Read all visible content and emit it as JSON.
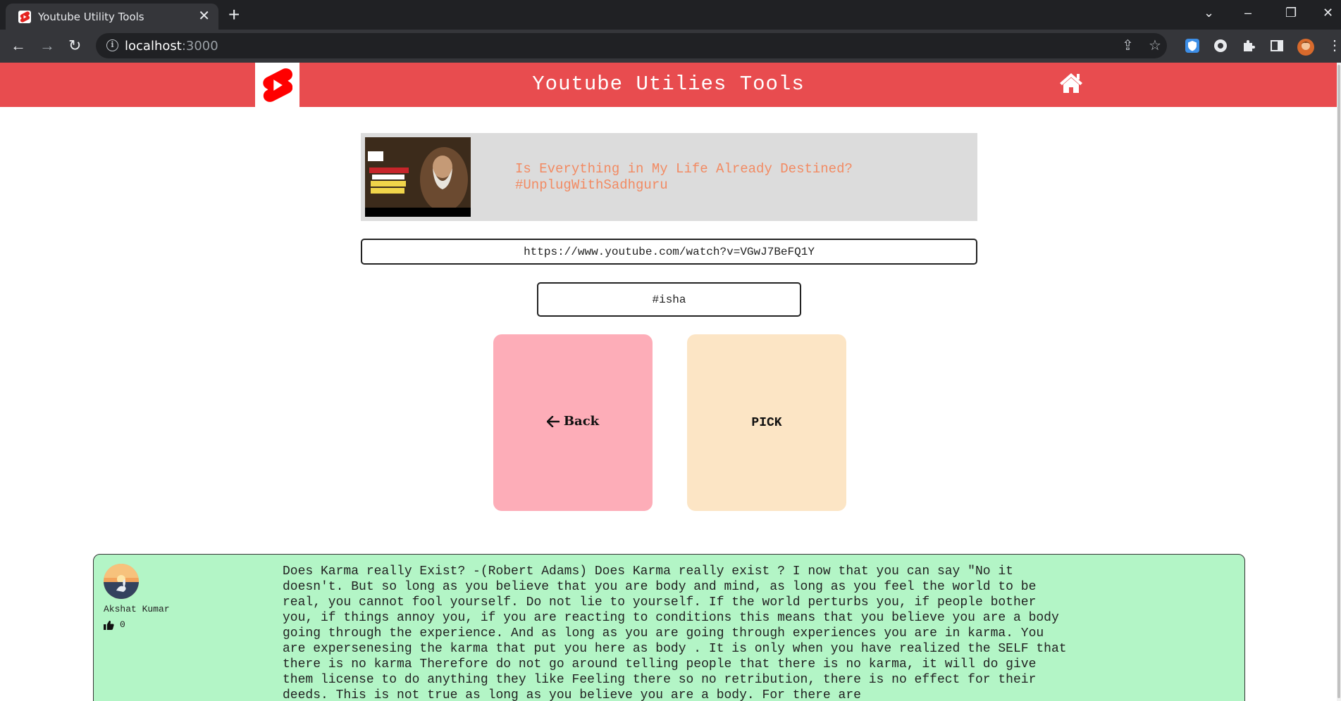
{
  "browser": {
    "tab_title": "Youtube Utility Tools",
    "tab_close": "✕",
    "new_tab": "+",
    "url_host": "localhost",
    "url_port": ":3000"
  },
  "header": {
    "title": "Youtube Utilies Tools",
    "logo_icon": "youtube-shorts-icon",
    "home_icon": "home-icon",
    "color": "#e84c4f"
  },
  "video": {
    "thumbnail_icon": "video-thumbnail",
    "title": "Is Everything in My Life Already Destined? #UnplugWithSadhguru"
  },
  "inputs": {
    "url_value": "https://www.youtube.com/watch?v=VGwJ7BeFQ1Y",
    "tag_value": "#isha"
  },
  "buttons": {
    "back_label": "Back",
    "pick_label": "PICK"
  },
  "comment": {
    "author": "Akshat Kumar",
    "likes": "0",
    "text": "Does Karma really Exist? -(Robert Adams) Does Karma really exist ? I now that you can say \"No it doesn't. But so long as you believe that you are body and mind, as long as you feel the world to be real, you cannot fool yourself. Do not lie to yourself. If the world perturbs you, if people bother you, if things annoy you, if you are reacting to conditions this means that you believe you are a body going through the experience. And as long as you are going through experiences you are in karma. You are expersenesing the karma that put you here as body . It is only when you have realized the SELF that there is no karma Therefore do not go around telling people that there is no karma, it will do give them license to do anything they like Feeling there so no retribution, there is no effect for their deeds. This is not true as long as you believe you are a body. For there are"
  }
}
